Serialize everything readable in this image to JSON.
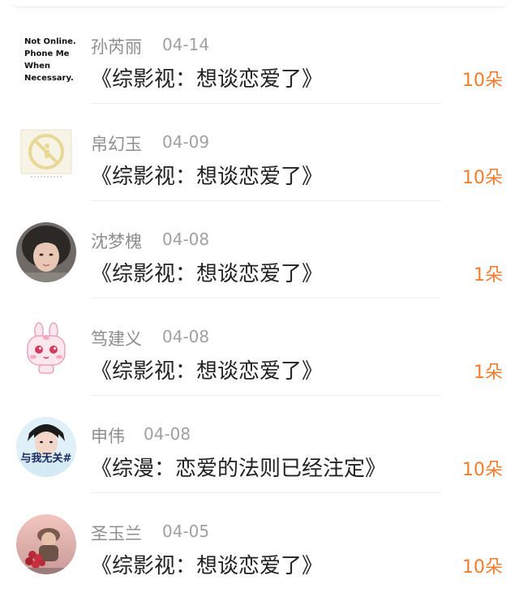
{
  "posts": [
    {
      "author": "孙芮丽",
      "date": "04-14",
      "title": "《综影视：想谈恋爱了》",
      "flowers": "10朵",
      "avatar": {
        "kind": "text-avatar",
        "lines": [
          "Not Online.",
          "Phone Me",
          "When",
          "Necessary."
        ]
      }
    },
    {
      "author": "帛幻玉",
      "date": "04-09",
      "title": "《综影视：想谈恋爱了》",
      "flowers": "10朵",
      "avatar": {
        "kind": "no-entry-sign-icon"
      }
    },
    {
      "author": "沈梦槐",
      "date": "04-08",
      "title": "《综影视：想谈恋爱了》",
      "flowers": "1朵",
      "avatar": {
        "kind": "photo-girl"
      }
    },
    {
      "author": "笃建义",
      "date": "04-08",
      "title": "《综影视：想谈恋爱了》",
      "flowers": "1朵",
      "avatar": {
        "kind": "cartoon-bunny"
      }
    },
    {
      "author": "申伟",
      "date": "04-08",
      "title": "《综漫：恋爱的法则已经注定》",
      "flowers": "10朵",
      "avatar": {
        "kind": "photo-boy",
        "ribbon_text": "与我无关#"
      }
    },
    {
      "author": "圣玉兰",
      "date": "04-05",
      "title": "《综影视：想谈恋爱了》",
      "flowers": "10朵",
      "avatar": {
        "kind": "photo-flowers"
      }
    }
  ],
  "colors": {
    "accent": "#f27c2c",
    "name_gray": "#8e8e8e",
    "title_black": "#222222"
  }
}
